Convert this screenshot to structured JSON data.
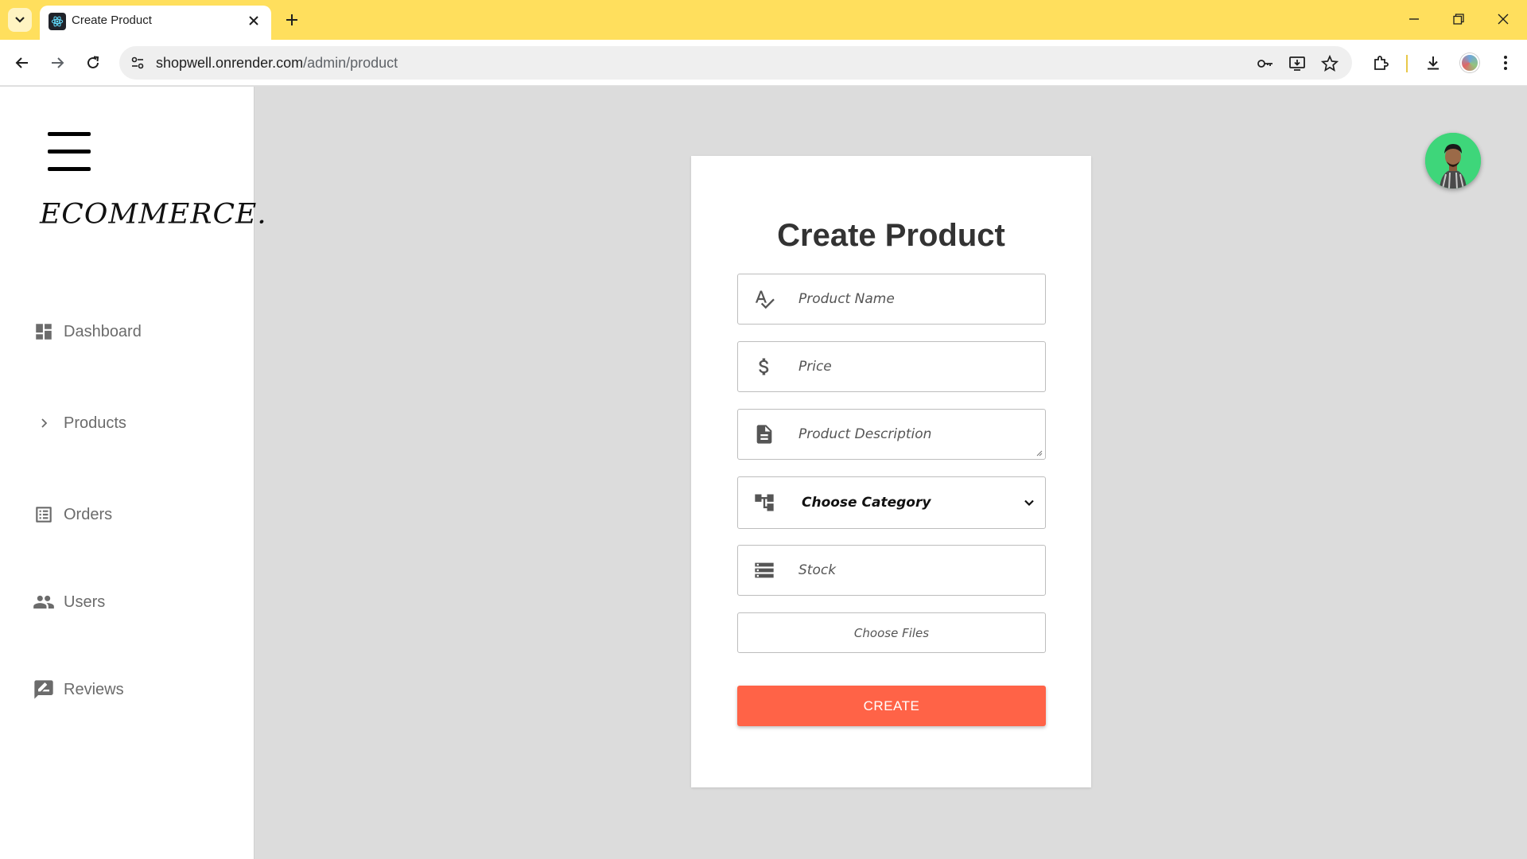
{
  "browser": {
    "tab_title": "Create Product",
    "url_host": "shopwell.onrender.com",
    "url_path": "/admin/product",
    "accent": "#ffdf5d"
  },
  "sidebar": {
    "brand": "ECOMMERCE.",
    "items": [
      {
        "label": "Dashboard",
        "icon": "dashboard-icon"
      },
      {
        "label": "Products",
        "icon": "chevron-right-icon"
      },
      {
        "label": "Orders",
        "icon": "list-alt-icon"
      },
      {
        "label": "Users",
        "icon": "people-icon"
      },
      {
        "label": "Reviews",
        "icon": "rate-review-icon"
      }
    ]
  },
  "form": {
    "title": "Create Product",
    "product_name_placeholder": "Product Name",
    "price_placeholder": "Price",
    "description_placeholder": "Product Description",
    "category_selected": "Choose Category",
    "stock_placeholder": "Stock",
    "file_button": "Choose Files",
    "submit": "CREATE",
    "submit_color": "#ff6347"
  }
}
